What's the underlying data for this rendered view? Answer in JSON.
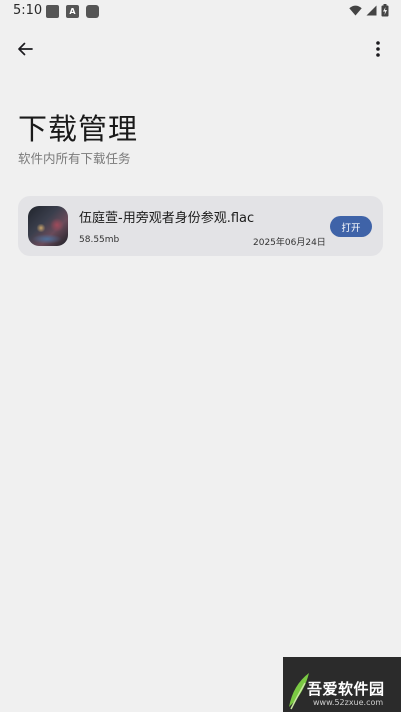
{
  "status_bar": {
    "time": "5:10",
    "notification_icons": [
      "square-icon",
      "a-icon",
      "rounded-square-icon"
    ],
    "notification_letter": "A",
    "right_icons": [
      "wifi-icon",
      "signal-icon",
      "battery-charging-icon"
    ]
  },
  "app_bar": {
    "back_icon": "arrow-left-icon",
    "menu_icon": "more-vertical-icon"
  },
  "header": {
    "title": "下载管理",
    "subtitle": "软件内所有下载任务"
  },
  "downloads": [
    {
      "file_name": "伍庭萱-用旁观者身份参观.flac",
      "size": "58.55mb",
      "date": "2025年06月24日",
      "action_label": "打开"
    }
  ],
  "watermark": {
    "text": "吾爱软件园",
    "url": "www.52zxue.com"
  },
  "colors": {
    "background": "#f0f0f0",
    "card": "#e3e3e6",
    "accent": "#3f63a8"
  }
}
